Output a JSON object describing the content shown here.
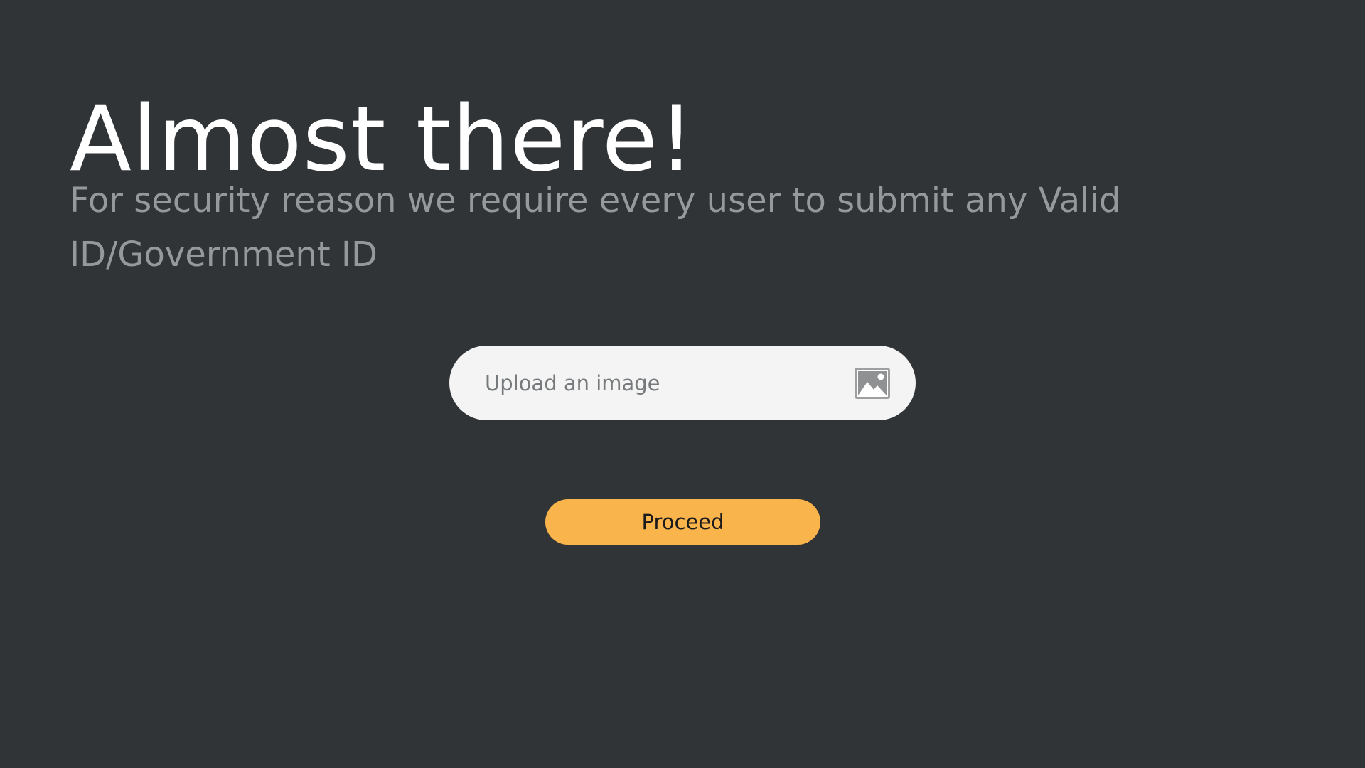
{
  "heading": "Almost there!",
  "subtitle": "For security reason we require every user to submit any Valid ID/Government ID",
  "upload": {
    "placeholder": "Upload an image",
    "icon": "image-icon"
  },
  "proceed_label": "Proceed",
  "colors": {
    "background": "#313437",
    "heading": "#ffffff",
    "subtitle": "#96999b",
    "field_background": "#f4f4f4",
    "accent": "#f9b44b"
  }
}
